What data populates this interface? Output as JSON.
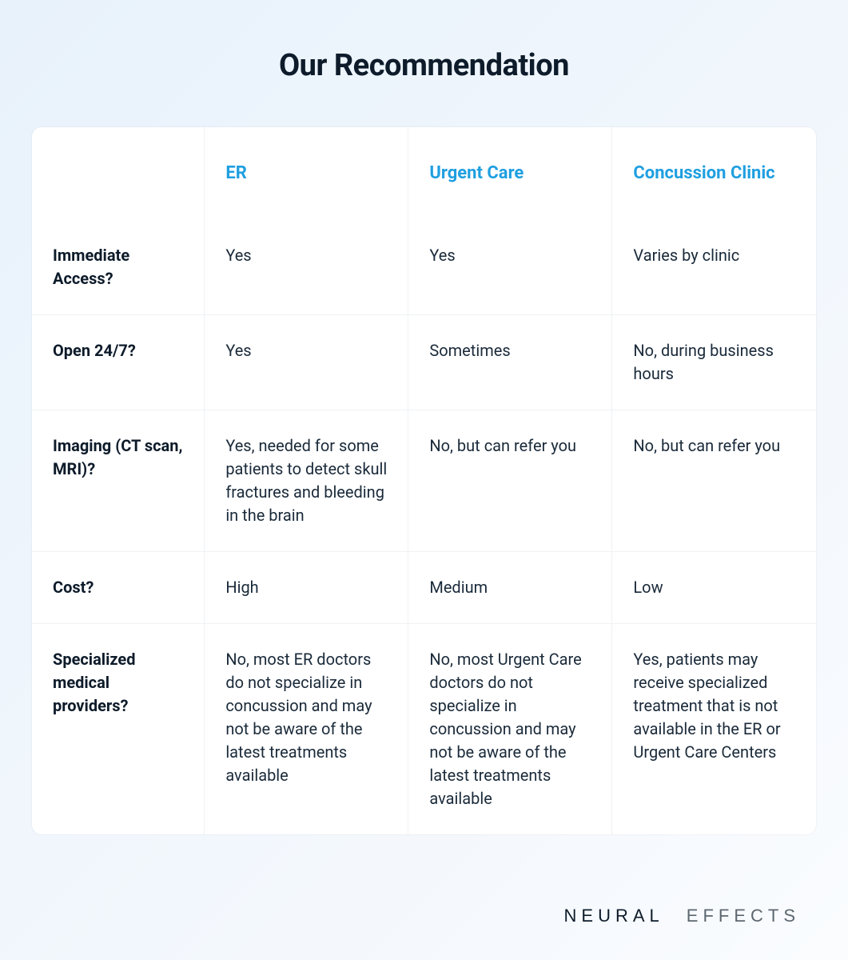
{
  "title": "Our Recommendation",
  "columns": [
    "ER",
    "Urgent Care",
    "Concussion Clinic"
  ],
  "rows": [
    {
      "label": "Immediate Access?",
      "values": [
        "Yes",
        "Yes",
        "Varies by clinic"
      ]
    },
    {
      "label": "Open 24/7?",
      "values": [
        "Yes",
        "Sometimes",
        "No, during business hours"
      ]
    },
    {
      "label": "Imaging (CT scan, MRI)?",
      "values": [
        "Yes, needed for some patients to detect skull fractures and bleeding in the brain",
        "No, but can refer you",
        "No, but can refer you"
      ]
    },
    {
      "label": "Cost?",
      "values": [
        "High",
        "Medium",
        "Low"
      ]
    },
    {
      "label": "Specialized medical providers?",
      "values": [
        "No, most ER doctors do not specialize in concussion and may not be aware of the latest treatments available",
        "No, most Urgent Care doctors do not specialize in concussion and may not be aware of the latest treatments available",
        "Yes, patients may receive specialized treatment that is not available in the ER or Urgent Care Centers"
      ]
    }
  ],
  "brand": {
    "part1": "NEURAL",
    "part2": "EFFECTS"
  },
  "chart_data": {
    "type": "table",
    "title": "Our Recommendation",
    "columns": [
      "",
      "ER",
      "Urgent Care",
      "Concussion Clinic"
    ],
    "rows": [
      [
        "Immediate Access?",
        "Yes",
        "Yes",
        "Varies by clinic"
      ],
      [
        "Open 24/7?",
        "Yes",
        "Sometimes",
        "No, during business hours"
      ],
      [
        "Imaging (CT scan, MRI)?",
        "Yes, needed for some patients to detect skull fractures and bleeding in the brain",
        "No, but can refer you",
        "No, but can refer you"
      ],
      [
        "Cost?",
        "High",
        "Medium",
        "Low"
      ],
      [
        "Specialized medical providers?",
        "No, most ER doctors do not specialize in concussion and may not be aware of the latest treatments available",
        "No, most Urgent Care doctors do not specialize in concussion and may not be aware of the latest treatments available",
        "Yes, patients may receive specialized treatment that is not available in the ER or Urgent Care Centers"
      ]
    ]
  }
}
